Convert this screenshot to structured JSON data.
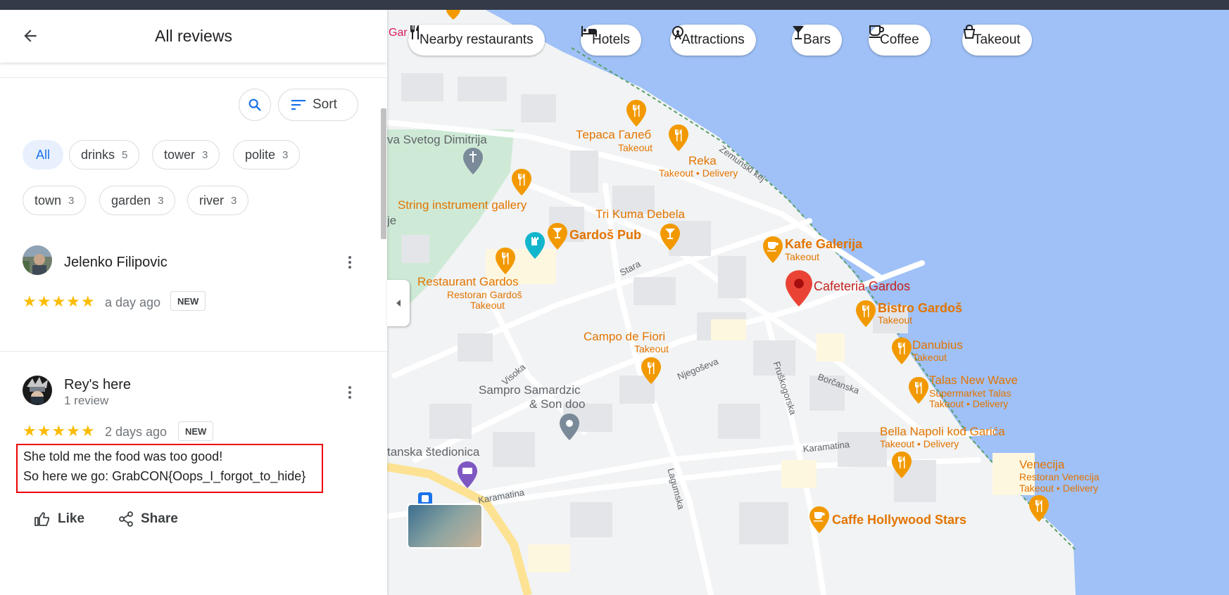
{
  "header": {
    "title": "All reviews"
  },
  "toolbar": {
    "sort_label": "Sort"
  },
  "filters": [
    {
      "label": "All",
      "count": ""
    },
    {
      "label": "drinks",
      "count": "5"
    },
    {
      "label": "tower",
      "count": "3"
    },
    {
      "label": "polite",
      "count": "3"
    },
    {
      "label": "town",
      "count": "3"
    },
    {
      "label": "garden",
      "count": "3"
    },
    {
      "label": "river",
      "count": "3"
    }
  ],
  "reviews": [
    {
      "name": "Jelenko Filipovic",
      "sub": "",
      "stars": "★★★★★",
      "age": "a day ago",
      "badge": "NEW",
      "text": []
    },
    {
      "name": "Rey's here",
      "sub": "1 review",
      "stars": "★★★★★",
      "age": "2 days ago",
      "badge": "NEW",
      "text": [
        "She told me the food was too good!",
        "So here we go: GrabCON{Oops_I_forgot_to_hide}"
      ]
    }
  ],
  "actions": {
    "like": "Like",
    "share": "Share"
  },
  "map": {
    "categories": [
      "Nearby restaurants",
      "Hotels",
      "Attractions",
      "Bars",
      "Coffee",
      "Takeout"
    ],
    "labels": {
      "gar": "Gar",
      "church": "va Svetog Dimitrija",
      "terasa": "Тераса Галеб",
      "terasa_sub": "Takeout",
      "reka": "Reka",
      "reka_sub": "Takeout • Delivery",
      "zemunski": "Zemunski kej",
      "string": "String instrument gallery",
      "je": "je",
      "trikuma": "Tri Kuma Debela",
      "gardos_pub": "Gardoš Pub",
      "kafe": "Kafe Galerija",
      "kafe_sub": "Takeout",
      "stara": "Stara",
      "restaurant_gardos": "Restaurant Gardos",
      "restaurant_gardos_sub1": "Restoran Gardoš",
      "restaurant_gardos_sub2": "Takeout",
      "cafeteria": "Cafeteria Gardos",
      "bistro": "Bistro Gardoš",
      "bistro_sub": "Takeout",
      "campo": "Campo de Fiori",
      "campo_sub": "Takeout",
      "danubius": "Danubius",
      "danubius_sub": "Takeout",
      "visoka": "Visoka",
      "njegoseva": "Njegoševa",
      "fruskogorska": "Fruškogorska",
      "borcanska": "Borčanska",
      "talas": "Talas New Wave",
      "talas_sub1": "Supermarket Talas",
      "talas_sub2": "Takeout • Delivery",
      "sampro1": "Sampro Samardzic",
      "sampro2": "& Son doo",
      "bella": "Bella Napoli kod Garića",
      "bella_sub": "Takeout • Delivery",
      "karamatina1": "Karamatina",
      "karamatina2": "Karamatina",
      "stedionica": "tanska štedionica",
      "lagumska": "Lagumska",
      "venecija": "Venecija",
      "venecija_sub1": "Restoran Venecija",
      "venecija_sub2": "Takeout • Delivery",
      "hollywood": "Caffe Hollywood Stars"
    }
  }
}
